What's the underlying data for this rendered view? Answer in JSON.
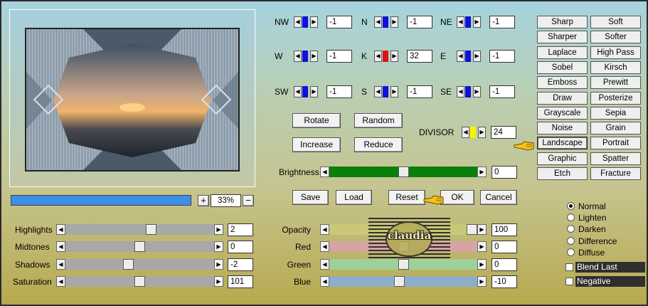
{
  "directions": {
    "nw": {
      "label": "NW",
      "value": "-1"
    },
    "n": {
      "label": "N",
      "value": "-1"
    },
    "ne": {
      "label": "NE",
      "value": "-1"
    },
    "w": {
      "label": "W",
      "value": "-1"
    },
    "k": {
      "label": "K",
      "value": "32"
    },
    "e": {
      "label": "E",
      "value": "-1"
    },
    "sw": {
      "label": "SW",
      "value": "-1"
    },
    "s": {
      "label": "S",
      "value": "-1"
    },
    "se": {
      "label": "SE",
      "value": "-1"
    }
  },
  "actions": {
    "rotate": "Rotate",
    "random": "Random",
    "increase": "Increase",
    "reduce": "Reduce"
  },
  "divisor": {
    "label": "DIVISOR",
    "value": "24"
  },
  "brightness": {
    "label": "Brightness",
    "value": "0",
    "level": 0.5
  },
  "dialog": {
    "save": "Save",
    "load": "Load",
    "reset": "Reset",
    "ok": "OK",
    "cancel": "Cancel"
  },
  "zoom": {
    "plus": "+",
    "minus": "−",
    "value": "33%",
    "progress": 1.0
  },
  "presets_left": [
    "Sharp",
    "Sharper",
    "Laplace",
    "Sobel",
    "Emboss",
    "Draw",
    "Grayscale",
    "Noise",
    "Landscape",
    "Graphic",
    "Etch"
  ],
  "presets_right": [
    "Soft",
    "Softer",
    "High Pass",
    "Kirsch",
    "Prewitt",
    "Posterize",
    "Sepia",
    "Grain",
    "Portrait",
    "Spatter",
    "Fracture"
  ],
  "tones": [
    {
      "label": "Highlights",
      "value": "2",
      "level": 0.58
    },
    {
      "label": "Midtones",
      "value": "0",
      "level": 0.5
    },
    {
      "label": "Shadows",
      "value": "-2",
      "level": 0.42
    },
    {
      "label": "Saturation",
      "value": "101",
      "level": 0.5
    }
  ],
  "channels": [
    {
      "label": "Opacity",
      "value": "100",
      "level": 1.0,
      "color": "#c9c878"
    },
    {
      "label": "Red",
      "value": "0",
      "level": 0.5,
      "color": "#d7a4a4"
    },
    {
      "label": "Green",
      "value": "0",
      "level": 0.5,
      "color": "#9dd09a"
    },
    {
      "label": "Blue",
      "value": "-10",
      "level": 0.47,
      "color": "#8caec9"
    }
  ],
  "blend_modes": {
    "options": [
      "Normal",
      "Lighten",
      "Darken",
      "Difference",
      "Diffuse"
    ],
    "selected": "Normal"
  },
  "blend_last": {
    "label": "Blend Last",
    "checked": false
  },
  "negative": {
    "label": "Negative",
    "checked": false
  },
  "watermark": "claudia",
  "colors": {
    "blue_marker": "#1010d8",
    "red_marker": "#e01010",
    "yellow_marker": "#f4f400",
    "brightness_bar": "#0a7f0a",
    "progress": "#3d8fe8"
  }
}
